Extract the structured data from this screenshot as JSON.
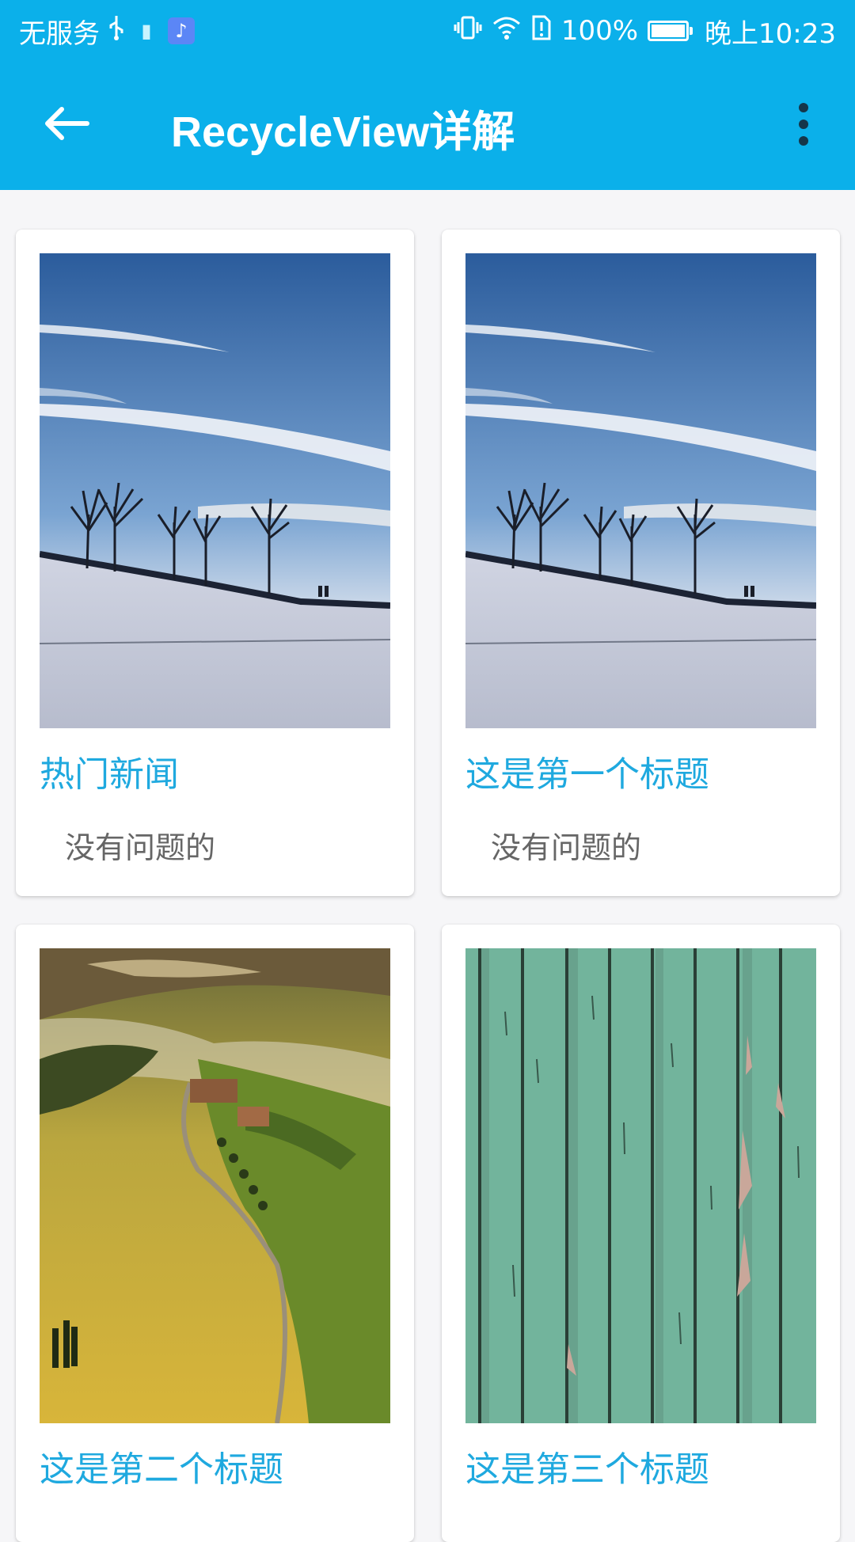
{
  "status_bar": {
    "carrier": "无服务",
    "usb_icon": "usb-icon",
    "app_icon_1": "book-icon",
    "app_icon_2": "music-icon",
    "vibrate_icon": "vibrate-icon",
    "wifi_icon": "wifi-icon",
    "sim_icon": "sim-alert-icon",
    "battery_percent": "100%",
    "time": "晚上10:23"
  },
  "toolbar": {
    "back_icon": "arrow-left-icon",
    "title": "RecycleView详解",
    "menu_icon": "more-vertical-icon"
  },
  "cards": [
    {
      "title": "热门新闻",
      "subtitle": "没有问题的",
      "image": "winter-snow-trees"
    },
    {
      "title": "这是第一个标题",
      "subtitle": "没有问题的",
      "image": "winter-snow-trees"
    },
    {
      "title": "这是第二个标题",
      "subtitle": "",
      "image": "tuscany-hills-road"
    },
    {
      "title": "这是第三个标题",
      "subtitle": "",
      "image": "green-painted-wood"
    }
  ],
  "colors": {
    "primary": "#0bb0ea",
    "card_title": "#1fa9df",
    "card_subtitle": "#666666",
    "background": "#f6f6f8"
  }
}
